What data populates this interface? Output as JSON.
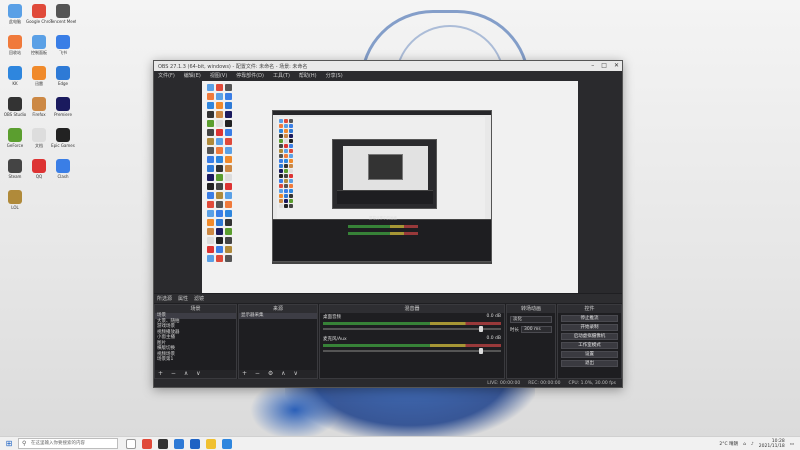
{
  "obs": {
    "title": "OBS 27.1.3 (64-bit, windows) - 配置文件: 未命名 - 场景: 未命名",
    "menu": [
      "文件(F)",
      "编辑(E)",
      "视图(V)",
      "停靠部件(D)",
      "工具(T)",
      "帮助(H)",
      "分享(S)"
    ],
    "dock_header": [
      "所选源",
      "属性",
      "滤镜"
    ],
    "scenes": {
      "title": "场景",
      "items": [
        "场景",
        "大景、随拍",
        "游戏场景",
        "视频播放器",
        "小窗主播",
        "图片",
        "横版切换",
        "视频场景",
        "场景第1"
      ],
      "footer": "+ − ∧ ∨"
    },
    "sources": {
      "title": "来源",
      "items": [
        "显示器采集"
      ],
      "footer": "+ − ⚙ ∧ ∨"
    },
    "mixer": {
      "title": "混音器",
      "channels": [
        {
          "name": "桌面音频",
          "db": "0.0 dB"
        },
        {
          "name": "麦克风/Aux",
          "db": "0.0 dB"
        }
      ]
    },
    "transitions": {
      "title": "转场动画",
      "type": "淡化",
      "duration_label": "时长",
      "duration": "300 ms"
    },
    "controls": {
      "title": "控件",
      "buttons": [
        "停止推流",
        "开始录制",
        "启动虚拟摄像机",
        "工作室模式",
        "设置",
        "退出"
      ]
    },
    "status": {
      "live": "LIVE: 00:00:00",
      "rec": "REC: 00:00:00",
      "cpu": "CPU: 1.0%, 30.00 fps"
    },
    "nested_preview_label": "屏幕分享中的画面"
  },
  "desktop": {
    "icons": [
      {
        "label": "此电脑",
        "color": "#5aa0e6"
      },
      {
        "label": "Google Chrome",
        "color": "#e04a3a"
      },
      {
        "label": "Tencent Meeting",
        "color": "#555"
      },
      {
        "label": "回收站",
        "color": "#f07a3b"
      },
      {
        "label": "控制面板",
        "color": "#5aa0e6"
      },
      {
        "label": "飞书",
        "color": "#3a7ee6"
      },
      {
        "label": "KK",
        "color": "#2e86de"
      },
      {
        "label": "迅雷",
        "color": "#f08a2b"
      },
      {
        "label": "Edge",
        "color": "#2e7ad6"
      },
      {
        "label": "OBS Studio",
        "color": "#333"
      },
      {
        "label": "Firefox",
        "color": "#cc8844"
      },
      {
        "label": "Premiere",
        "color": "#1a1a5e"
      },
      {
        "label": "GeForce",
        "color": "#5b9e2f"
      },
      {
        "label": "文档",
        "color": "#ddd"
      },
      {
        "label": "Epic Games",
        "color": "#222"
      },
      {
        "label": "Steam",
        "color": "#444"
      },
      {
        "label": "QQ",
        "color": "#d33"
      },
      {
        "label": "Clash",
        "color": "#3a7ee6"
      },
      {
        "label": "LOL",
        "color": "#b08a3a"
      }
    ]
  },
  "taskbar": {
    "search_placeholder": "在这里输入你要搜索的内容",
    "weather": "2°C 晴朗",
    "time": "10:28",
    "date": "2021/11/18"
  },
  "colors": {
    "obs_bg": "#1f1f22",
    "accent_blue": "#1e63c4"
  }
}
